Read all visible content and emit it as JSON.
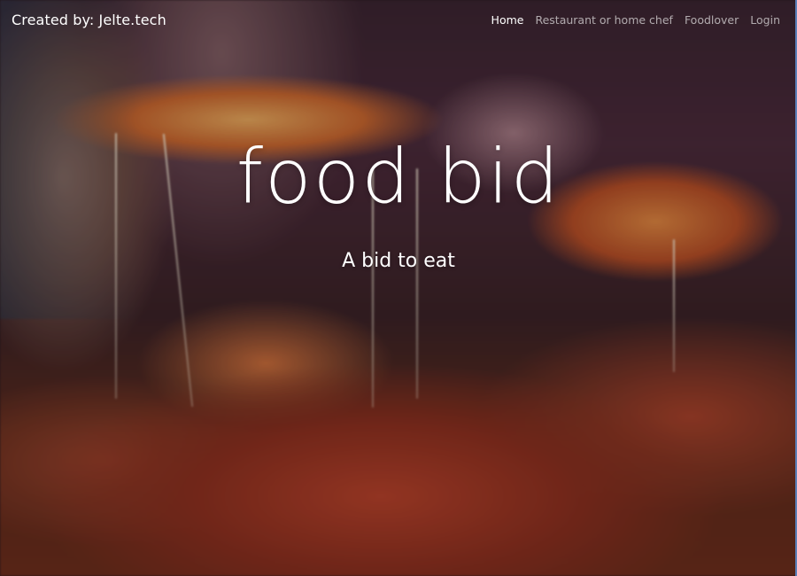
{
  "navbar": {
    "brand": "Created by: Jelte.tech",
    "links": [
      {
        "label": "Home",
        "active": true
      },
      {
        "label": "Restaurant or home chef",
        "active": false
      },
      {
        "label": "Foodlover",
        "active": false
      },
      {
        "label": "Login",
        "active": false
      }
    ]
  },
  "hero": {
    "title": "food bid",
    "subtitle": "A bid to eat",
    "background": "pizza-photo"
  },
  "colors": {
    "text": "#ffffff",
    "nav_inactive": "#ffffff9e"
  }
}
